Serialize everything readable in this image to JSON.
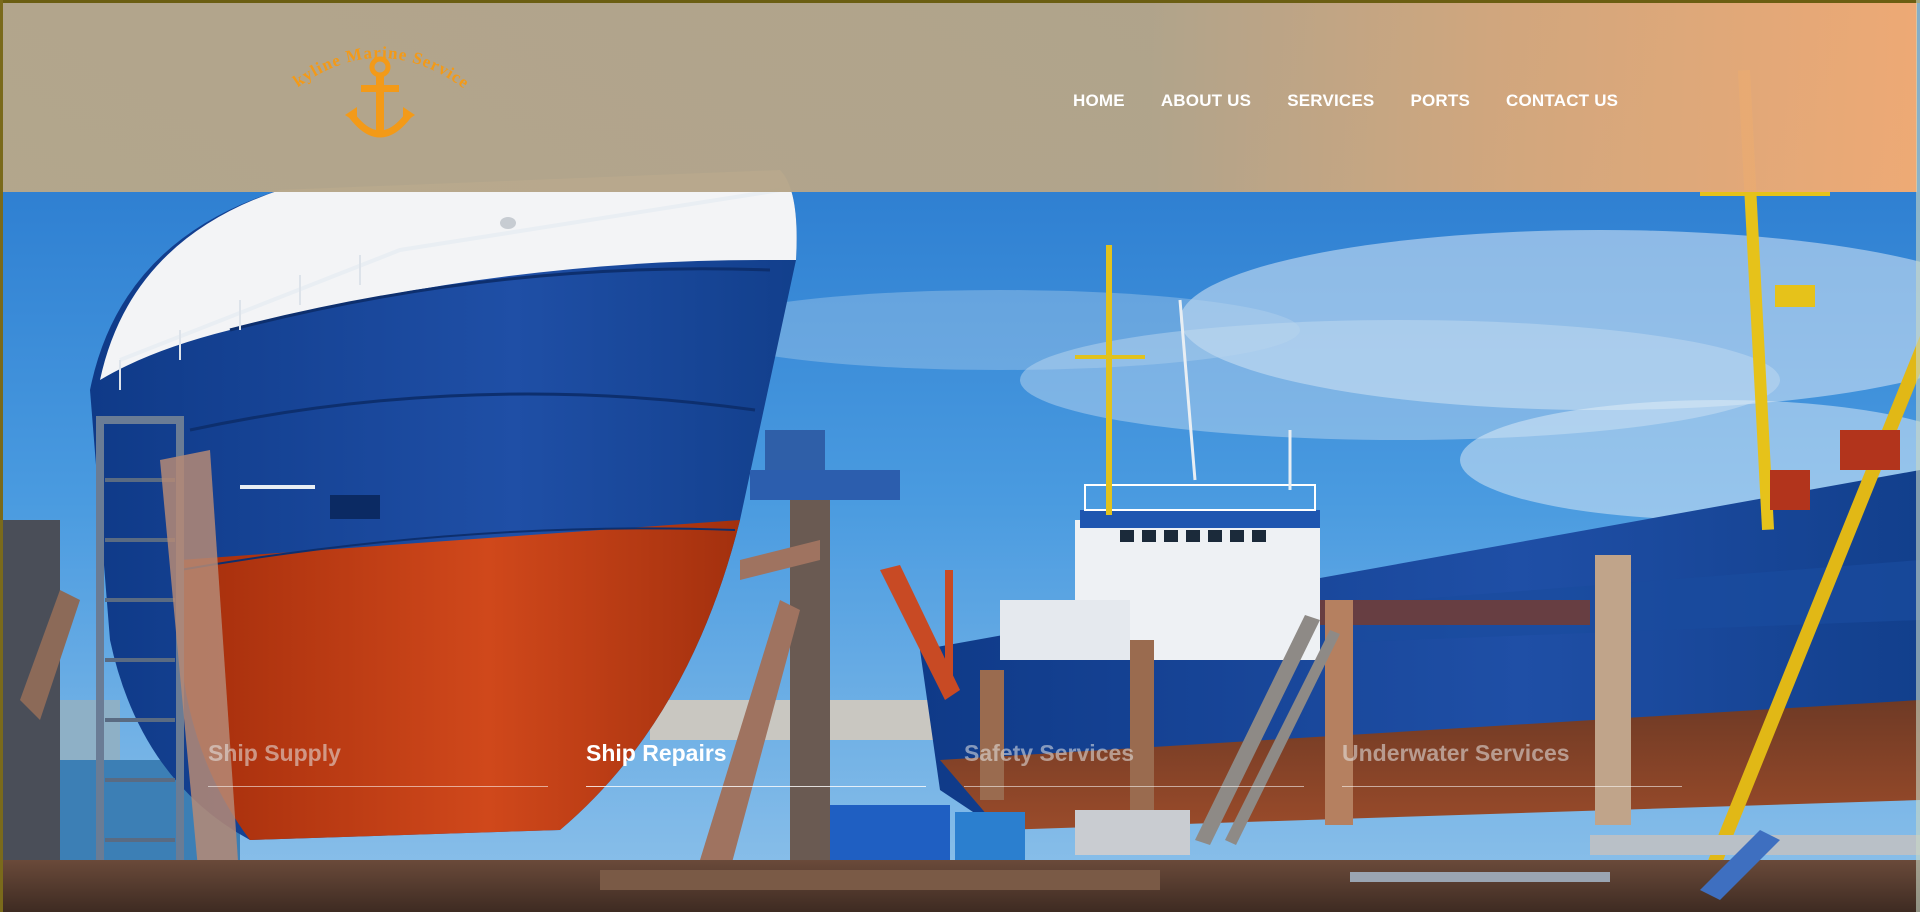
{
  "brand": {
    "logo_text": "Skyline Marine Services",
    "accent": "#f39a18"
  },
  "nav": {
    "items": [
      {
        "label": "HOME"
      },
      {
        "label": "ABOUT US"
      },
      {
        "label": "SERVICES"
      },
      {
        "label": "PORTS"
      },
      {
        "label": "CONTACT US"
      }
    ]
  },
  "services": {
    "items": [
      {
        "label": "Ship Supply",
        "active": false
      },
      {
        "label": "Ship Repairs",
        "active": true
      },
      {
        "label": "Safety Services",
        "active": false
      },
      {
        "label": "Underwater Services",
        "active": false
      }
    ]
  },
  "colors": {
    "header_overlay": "#b7a78a",
    "header_overlay_right": "#f4ab72",
    "sky": "#2f86d6",
    "hull_blue": "#123f8c",
    "hull_red": "#b8350e"
  }
}
